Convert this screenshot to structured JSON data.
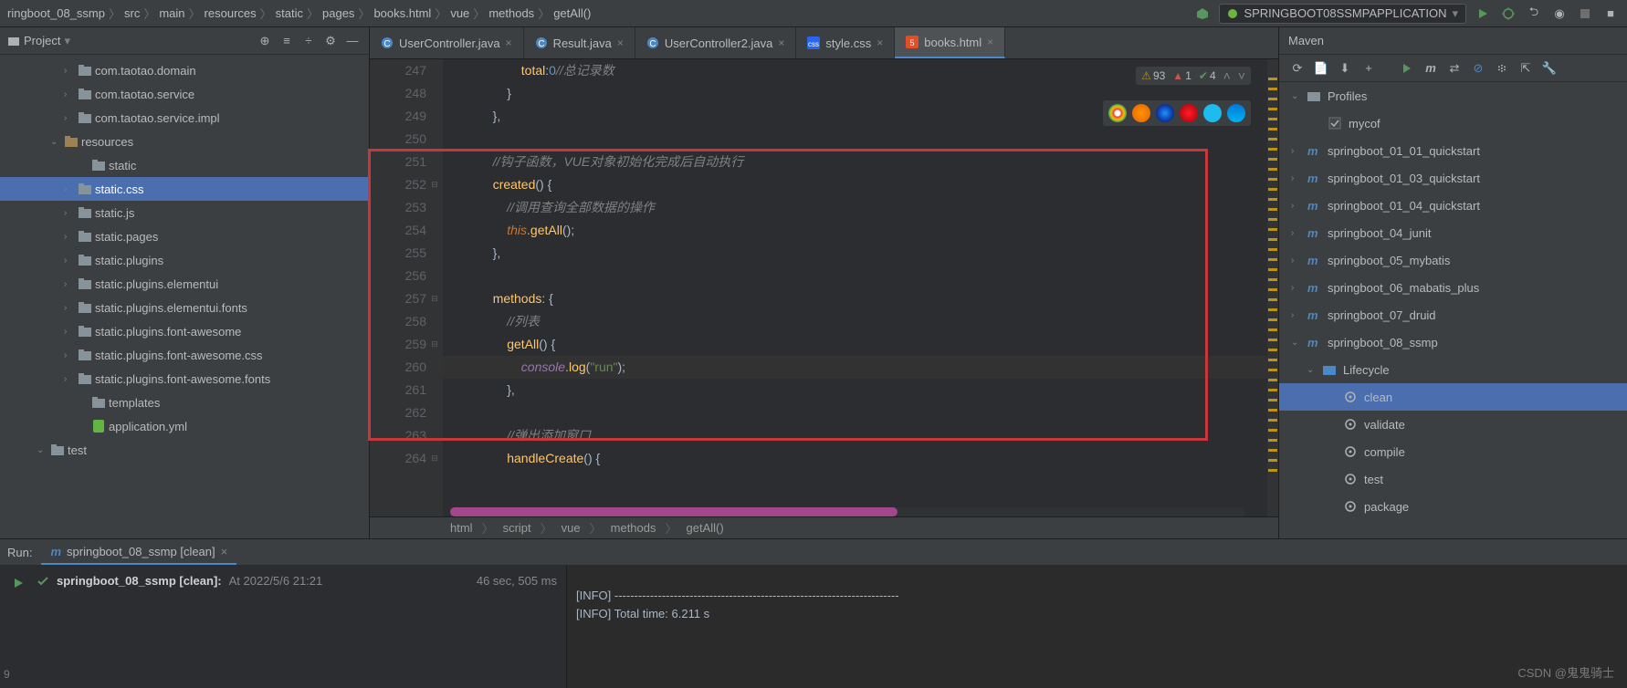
{
  "breadcrumb": [
    "ringboot_08_ssmp",
    "src",
    "main",
    "resources",
    "static",
    "pages",
    "books.html",
    "vue",
    "methods",
    "getAll()"
  ],
  "runConfig": "SPRINGBOOT08SSMPAPPLICATION",
  "project": {
    "title": "Project",
    "tree": [
      {
        "indent": 70,
        "chev": "›",
        "type": "folder",
        "label": "com.taotao.domain"
      },
      {
        "indent": 70,
        "chev": "›",
        "type": "folder",
        "label": "com.taotao.service"
      },
      {
        "indent": 70,
        "chev": "›",
        "type": "folder",
        "label": "com.taotao.service.impl"
      },
      {
        "indent": 55,
        "chev": "⌄",
        "type": "res",
        "label": "resources"
      },
      {
        "indent": 85,
        "chev": "",
        "type": "folder",
        "label": "static"
      },
      {
        "indent": 70,
        "chev": "›",
        "type": "folder",
        "label": "static.css",
        "selected": true
      },
      {
        "indent": 70,
        "chev": "›",
        "type": "folder",
        "label": "static.js"
      },
      {
        "indent": 70,
        "chev": "›",
        "type": "folder",
        "label": "static.pages"
      },
      {
        "indent": 70,
        "chev": "›",
        "type": "folder",
        "label": "static.plugins"
      },
      {
        "indent": 70,
        "chev": "›",
        "type": "folder",
        "label": "static.plugins.elementui"
      },
      {
        "indent": 70,
        "chev": "›",
        "type": "folder",
        "label": "static.plugins.elementui.fonts"
      },
      {
        "indent": 70,
        "chev": "›",
        "type": "folder",
        "label": "static.plugins.font-awesome"
      },
      {
        "indent": 70,
        "chev": "›",
        "type": "folder",
        "label": "static.plugins.font-awesome.css"
      },
      {
        "indent": 70,
        "chev": "›",
        "type": "folder",
        "label": "static.plugins.font-awesome.fonts"
      },
      {
        "indent": 85,
        "chev": "",
        "type": "folder",
        "label": "templates"
      },
      {
        "indent": 85,
        "chev": "",
        "type": "yml",
        "label": "application.yml"
      },
      {
        "indent": 40,
        "chev": "⌄",
        "type": "folder",
        "label": "test"
      }
    ]
  },
  "tabs": [
    {
      "icon": "class",
      "label": "UserController.java",
      "active": false
    },
    {
      "icon": "class",
      "label": "Result.java",
      "active": false
    },
    {
      "icon": "class",
      "label": "UserController2.java",
      "active": false
    },
    {
      "icon": "css",
      "label": "style.css",
      "active": false
    },
    {
      "icon": "html",
      "label": "books.html",
      "active": true
    }
  ],
  "code": {
    "start": 247,
    "lines": [
      {
        "seg": [
          {
            "c": "txt",
            "t": "                    "
          },
          {
            "c": "prop",
            "t": "total"
          },
          {
            "c": "punc",
            "t": ":"
          },
          {
            "c": "num",
            "t": "0"
          },
          {
            "c": "cmt",
            "t": "//总记录数"
          }
        ]
      },
      {
        "seg": [
          {
            "c": "txt",
            "t": "                }"
          }
        ]
      },
      {
        "seg": [
          {
            "c": "txt",
            "t": "            },"
          }
        ]
      },
      {
        "seg": [
          {
            "c": "txt",
            "t": ""
          }
        ]
      },
      {
        "seg": [
          {
            "c": "txt",
            "t": "            "
          },
          {
            "c": "cmt",
            "t": "//钩子函数，VUE对象初始化完成后自动执行"
          }
        ]
      },
      {
        "seg": [
          {
            "c": "txt",
            "t": "            "
          },
          {
            "c": "fn",
            "t": "created"
          },
          {
            "c": "punc",
            "t": "() {"
          }
        ]
      },
      {
        "seg": [
          {
            "c": "txt",
            "t": "                "
          },
          {
            "c": "cmt",
            "t": "//调用查询全部数据的操作"
          }
        ]
      },
      {
        "seg": [
          {
            "c": "txt",
            "t": "                "
          },
          {
            "c": "kw",
            "t": "this"
          },
          {
            "c": "punc",
            "t": "."
          },
          {
            "c": "fn",
            "t": "getAll"
          },
          {
            "c": "punc",
            "t": "();"
          }
        ]
      },
      {
        "seg": [
          {
            "c": "txt",
            "t": "            },"
          }
        ]
      },
      {
        "seg": [
          {
            "c": "txt",
            "t": ""
          }
        ]
      },
      {
        "seg": [
          {
            "c": "txt",
            "t": "            "
          },
          {
            "c": "prop",
            "t": "methods"
          },
          {
            "c": "punc",
            "t": ": {"
          }
        ]
      },
      {
        "seg": [
          {
            "c": "txt",
            "t": "                "
          },
          {
            "c": "cmt",
            "t": "//列表"
          }
        ]
      },
      {
        "seg": [
          {
            "c": "txt",
            "t": "                "
          },
          {
            "c": "fn",
            "t": "getAll"
          },
          {
            "c": "punc",
            "t": "() {"
          }
        ]
      },
      {
        "hl": true,
        "seg": [
          {
            "c": "txt",
            "t": "                    "
          },
          {
            "c": "id",
            "t": "console"
          },
          {
            "c": "punc",
            "t": "."
          },
          {
            "c": "fn",
            "t": "log"
          },
          {
            "c": "punc",
            "t": "("
          },
          {
            "c": "str",
            "t": "\"run\""
          },
          {
            "c": "punc",
            "t": ");"
          }
        ]
      },
      {
        "seg": [
          {
            "c": "txt",
            "t": "                },"
          }
        ]
      },
      {
        "seg": [
          {
            "c": "txt",
            "t": ""
          }
        ]
      },
      {
        "seg": [
          {
            "c": "txt",
            "t": "                "
          },
          {
            "c": "cmt",
            "t": "//弹出添加窗口"
          }
        ]
      },
      {
        "seg": [
          {
            "c": "txt",
            "t": "                "
          },
          {
            "c": "fn",
            "t": "handleCreate"
          },
          {
            "c": "punc",
            "t": "() {"
          }
        ]
      }
    ]
  },
  "inspections": {
    "warn": "93",
    "err": "1",
    "ok": "4"
  },
  "botCrumb": [
    "html",
    "script",
    "vue",
    "methods",
    "getAll()"
  ],
  "maven": {
    "title": "Maven",
    "items": [
      {
        "indent": 5,
        "chev": "⌄",
        "type": "profiles",
        "label": "Profiles"
      },
      {
        "indent": 28,
        "chev": "",
        "type": "check",
        "label": "mycof"
      },
      {
        "indent": 5,
        "chev": "›",
        "type": "mvn",
        "label": "springboot_01_01_quickstart"
      },
      {
        "indent": 5,
        "chev": "›",
        "type": "mvn",
        "label": "springboot_01_03_quickstart"
      },
      {
        "indent": 5,
        "chev": "›",
        "type": "mvn",
        "label": "springboot_01_04_quickstart"
      },
      {
        "indent": 5,
        "chev": "›",
        "type": "mvn",
        "label": "springboot_04_junit"
      },
      {
        "indent": 5,
        "chev": "›",
        "type": "mvn",
        "label": "springboot_05_mybatis"
      },
      {
        "indent": 5,
        "chev": "›",
        "type": "mvn",
        "label": "springboot_06_mabatis_plus"
      },
      {
        "indent": 5,
        "chev": "›",
        "type": "mvn",
        "label": "springboot_07_druid"
      },
      {
        "indent": 5,
        "chev": "⌄",
        "type": "mvn",
        "label": "springboot_08_ssmp"
      },
      {
        "indent": 22,
        "chev": "⌄",
        "type": "life",
        "label": "Lifecycle"
      },
      {
        "indent": 45,
        "chev": "",
        "type": "goal",
        "label": "clean",
        "selected": true
      },
      {
        "indent": 45,
        "chev": "",
        "type": "goal",
        "label": "validate"
      },
      {
        "indent": 45,
        "chev": "",
        "type": "goal",
        "label": "compile"
      },
      {
        "indent": 45,
        "chev": "",
        "type": "goal",
        "label": "test"
      },
      {
        "indent": 45,
        "chev": "",
        "type": "goal",
        "label": "package"
      }
    ]
  },
  "run": {
    "label": "Run:",
    "tab": "springboot_08_ssmp [clean]",
    "status": "springboot_08_ssmp [clean]:",
    "statusTime": "At 2022/5/6 21:21",
    "duration": "46 sec, 505 ms",
    "console": [
      "[INFO] ------------------------------------------------------------------------",
      "[INFO] Total time:  6.211 s"
    ]
  },
  "watermark": "CSDN @鬼鬼骑士",
  "sideNum": "9"
}
